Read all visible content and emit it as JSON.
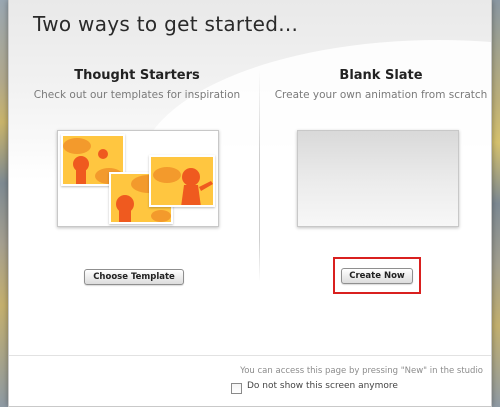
{
  "dialog": {
    "title": "Two ways to get started..."
  },
  "options": {
    "template": {
      "heading": "Thought Starters",
      "subtitle": "Check out our templates for inspiration",
      "button_label": "Choose Template"
    },
    "blank": {
      "heading": "Blank Slate",
      "subtitle": "Create your own animation from scratch",
      "button_label": "Create Now"
    }
  },
  "footer": {
    "note": "You can access this page by pressing \"New\" in the studio",
    "checkbox_label": "Do not show this screen anymore",
    "checkbox_checked": false
  },
  "colors": {
    "highlight": "#d9201f",
    "tile_yellow": "#ffc640",
    "figure_orange": "#ef5a1f"
  }
}
